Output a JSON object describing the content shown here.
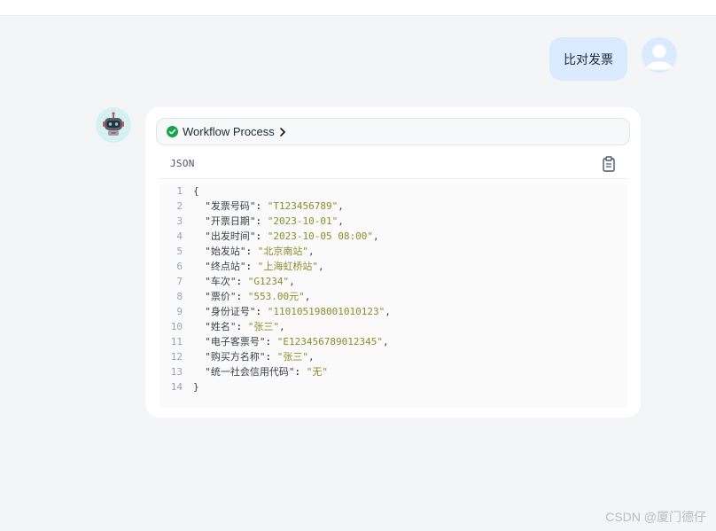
{
  "user_message": {
    "text": "比对发票"
  },
  "bot_message": {
    "workflow_label": "Workflow Process",
    "code_lang": "JSON",
    "lines": [
      {
        "no": "1",
        "text": "{"
      },
      {
        "no": "2",
        "key": "\"发票号码\"",
        "value": "\"T123456789\"",
        "comma": ","
      },
      {
        "no": "3",
        "key": "\"开票日期\"",
        "value": "\"2023-10-01\"",
        "comma": ","
      },
      {
        "no": "4",
        "key": "\"出发时间\"",
        "value": "\"2023-10-05 08:00\"",
        "comma": ","
      },
      {
        "no": "5",
        "key": "\"始发站\"",
        "value": "\"北京南站\"",
        "comma": ","
      },
      {
        "no": "6",
        "key": "\"终点站\"",
        "value": "\"上海虹桥站\"",
        "comma": ","
      },
      {
        "no": "7",
        "key": "\"车次\"",
        "value": "\"G1234\"",
        "comma": ","
      },
      {
        "no": "8",
        "key": "\"票价\"",
        "value": "\"553.00元\"",
        "comma": ","
      },
      {
        "no": "9",
        "key": "\"身份证号\"",
        "value": "\"110105198001010123\"",
        "comma": ","
      },
      {
        "no": "10",
        "key": "\"姓名\"",
        "value": "\"张三\"",
        "comma": ","
      },
      {
        "no": "11",
        "key": "\"电子客票号\"",
        "value": "\"E123456789012345\"",
        "comma": ","
      },
      {
        "no": "12",
        "key": "\"购买方名称\"",
        "value": "\"张三\"",
        "comma": ","
      },
      {
        "no": "13",
        "key": "\"统一社会信用代码\"",
        "value": "\"无\"",
        "comma": ""
      },
      {
        "no": "14",
        "text": "}"
      }
    ]
  },
  "watermark": "CSDN @厦门德仔",
  "colors": {
    "user_bubble": "#dbeafe",
    "string_value": "#8b8b2a",
    "check_green": "#16a34a"
  },
  "icons": {
    "workflow_status": "check-circle-icon",
    "workflow_expand": "chevron-right-icon",
    "copy": "clipboard-icon",
    "user_avatar": "user-avatar-icon",
    "bot_avatar": "robot-avatar-icon"
  }
}
